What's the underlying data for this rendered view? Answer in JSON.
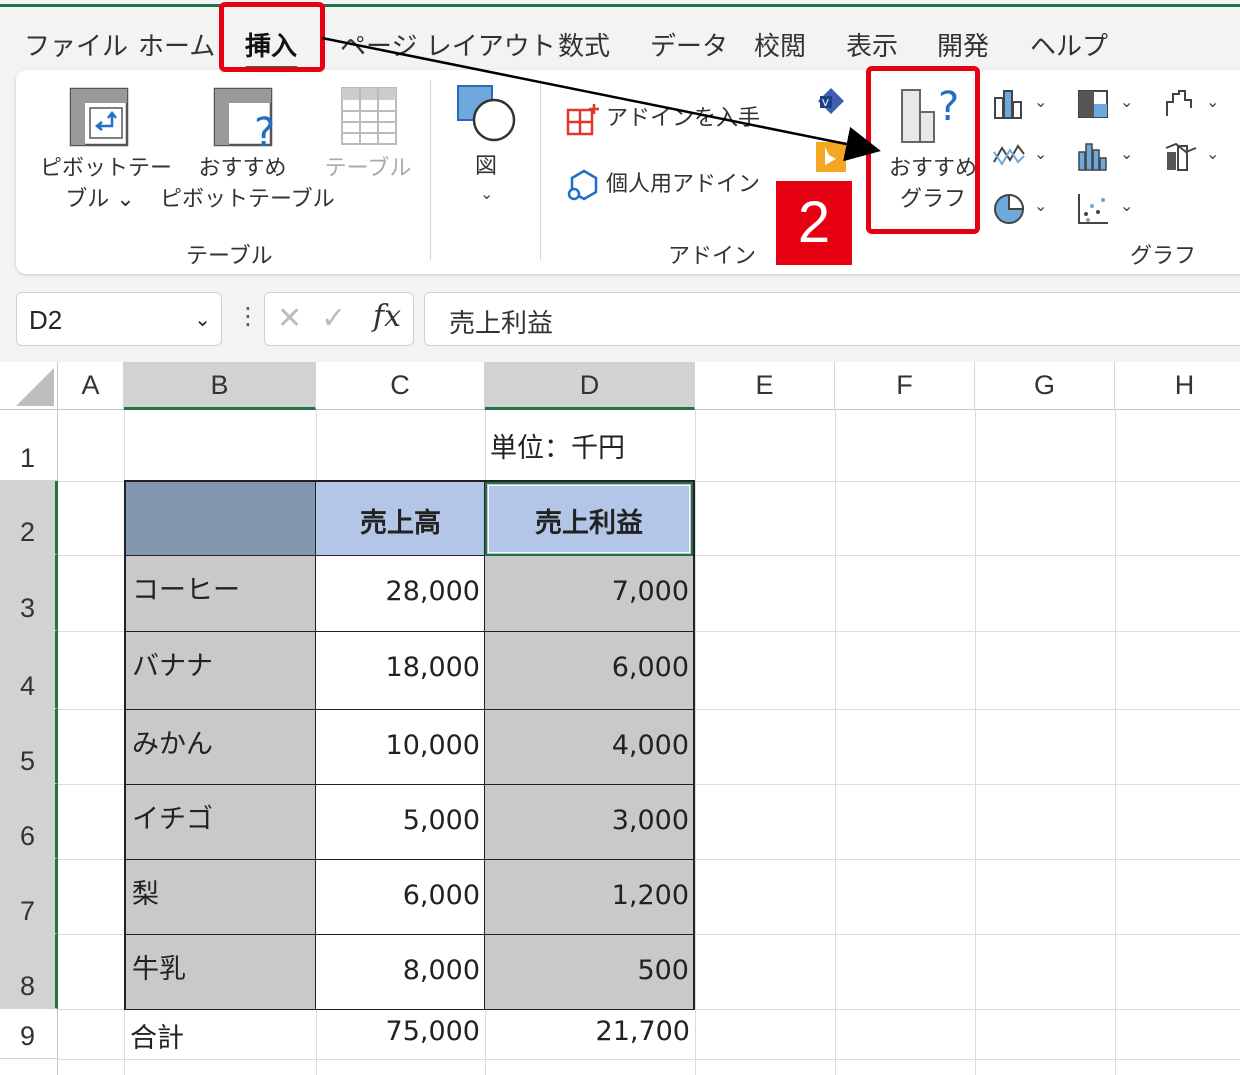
{
  "menu": {
    "tabs": [
      "ファイル",
      "ホーム",
      "挿入",
      "ページ レイアウト",
      "数式",
      "データ",
      "校閲",
      "表示",
      "開発",
      "ヘルプ"
    ],
    "active": "挿入"
  },
  "ribbon": {
    "pivot_table": [
      "ピボットテー",
      "ブル ⌄"
    ],
    "recommended_pivot": [
      "おすすめ",
      "ピボットテーブル"
    ],
    "table": "テーブル",
    "group_table": "テーブル",
    "illustrations": "図",
    "get_addins": "アドインを入手",
    "my_addins": "個人用アドイン",
    "group_addins": "アドイン",
    "recommended_charts": [
      "おすすめ",
      "グラフ"
    ],
    "group_charts": "グラフ"
  },
  "annotation": {
    "step_badge": "2"
  },
  "formula_bar": {
    "name_box": "D2",
    "formula": "売上利益"
  },
  "sheet": {
    "columns": [
      "A",
      "B",
      "C",
      "D",
      "E",
      "F",
      "G",
      "H"
    ],
    "rows": [
      "1",
      "2",
      "3",
      "4",
      "5",
      "6",
      "7",
      "8",
      "9"
    ],
    "unit_note": "単位：千円",
    "headers": [
      "",
      "売上高",
      "売上利益"
    ],
    "data": [
      [
        "コーヒー",
        "28,000",
        "7,000"
      ],
      [
        "バナナ",
        "18,000",
        "6,000"
      ],
      [
        "みかん",
        "10,000",
        "4,000"
      ],
      [
        "イチゴ",
        "5,000",
        "3,000"
      ],
      [
        "梨",
        "6,000",
        "1,200"
      ],
      [
        "牛乳",
        "8,000",
        "500"
      ]
    ],
    "total": [
      "合計",
      "75,000",
      "21,700"
    ]
  },
  "colors": {
    "accent_green": "#217346",
    "annotation_red": "#e60012",
    "header_dark": "#8497b0",
    "header_light": "#b4c6e7",
    "selected_gray": "#c9c9c9"
  }
}
